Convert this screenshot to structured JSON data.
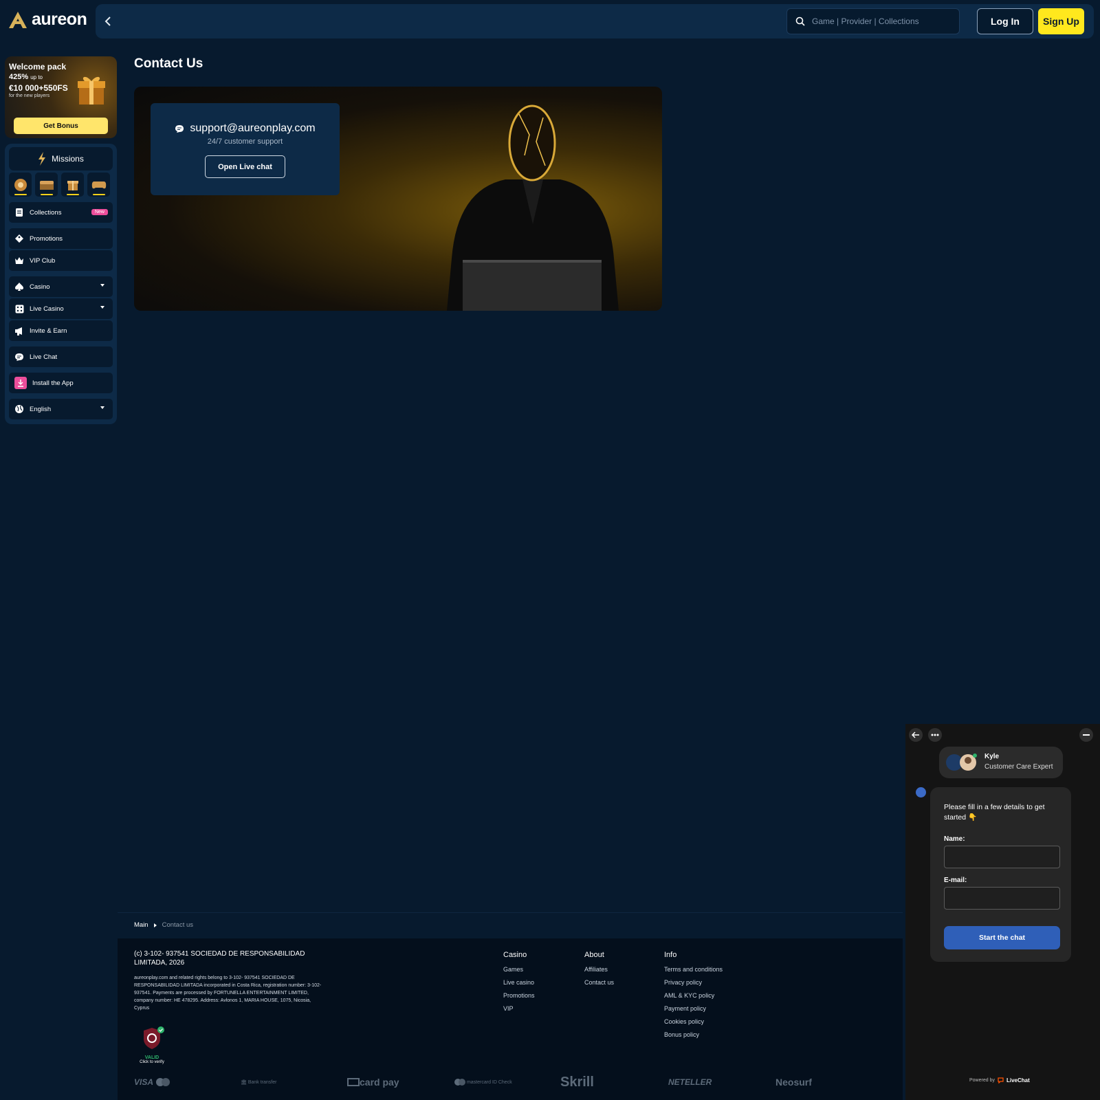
{
  "colors": {
    "accent": "#ffe81d",
    "primary_bg": "#071a2e",
    "panel_bg": "#0d2a47",
    "new_badge": "#ec4e9b",
    "chat_button": "#2f5fb8"
  },
  "header": {
    "logo": "aureon",
    "search_placeholder": "Game | Provider | Collections",
    "login_label": "Log In",
    "signup_label": "Sign Up"
  },
  "sidebar": {
    "welcome": {
      "title": "Welcome pack",
      "percent": "425%",
      "percent_suffix": "up to",
      "amount": "€10 000+550FS",
      "note": "for the new players",
      "cta": "Get Bonus"
    },
    "missions_label": "Missions",
    "items": [
      {
        "label": "Collections",
        "icon": "collections-icon",
        "badge": "New"
      },
      {
        "label": "Promotions",
        "icon": "promotions-icon"
      },
      {
        "label": "VIP Club",
        "icon": "crown-icon"
      },
      {
        "label": "Casino",
        "icon": "spade-icon"
      },
      {
        "label": "Live Casino",
        "icon": "dice-icon"
      },
      {
        "label": "Invite & Earn",
        "icon": "megaphone-icon"
      },
      {
        "label": "Live Chat",
        "icon": "chat-icon"
      },
      {
        "label": "Install the App",
        "icon": "download-icon"
      },
      {
        "label": "English",
        "icon": "globe-icon"
      }
    ]
  },
  "main": {
    "title": "Contact Us",
    "email": "support@aureonplay.com",
    "support_text": "24/7 customer support",
    "open_chat_label": "Open Live chat"
  },
  "breadcrumb": {
    "home": "Main",
    "current": "Contact us"
  },
  "footer": {
    "company": "(c) 3-102- 937541 SOCIEDAD DE RESPONSABILIDAD LIMITADA, 2026",
    "legal": "aureonplay.com and related rights belong to 3-102- 937541 SOCIEDAD DE RESPONSABILIDAD LIMITADA incorporated in Costa Rica, registration number: 3-102- 937541. Payments are processed by FORTUNELLA ENTERTAINMENT LIMITED, company number: HE 478295. Address: Avlonos 1, MARIA HOUSE, 1075, Nicosia, Cyprus",
    "valid_text": "VALID",
    "verify_text": "Click to verify",
    "columns": [
      {
        "title": "Casino",
        "links": [
          "Games",
          "Live casino",
          "Promotions",
          "VIP"
        ]
      },
      {
        "title": "About",
        "links": [
          "Affiliates",
          "Contact us"
        ]
      },
      {
        "title": "Info",
        "links": [
          "Terms and conditions",
          "Privacy policy",
          "AML & KYC policy",
          "Payment policy",
          "Cookies policy",
          "Bonus policy"
        ]
      }
    ],
    "payments": [
      "VISA",
      "Bank transfer",
      "card pay",
      "mastercard ID Check",
      "Skrill",
      "NETELLER",
      "Neosurf"
    ]
  },
  "chat": {
    "agent_name": "Kyle",
    "agent_role": "Customer Care Expert",
    "message": "Please fill in a few details to get started 👇",
    "name_label": "Name:",
    "email_label": "E-mail:",
    "start_label": "Start the chat",
    "powered_by": "Powered by",
    "brand": "LiveChat"
  }
}
